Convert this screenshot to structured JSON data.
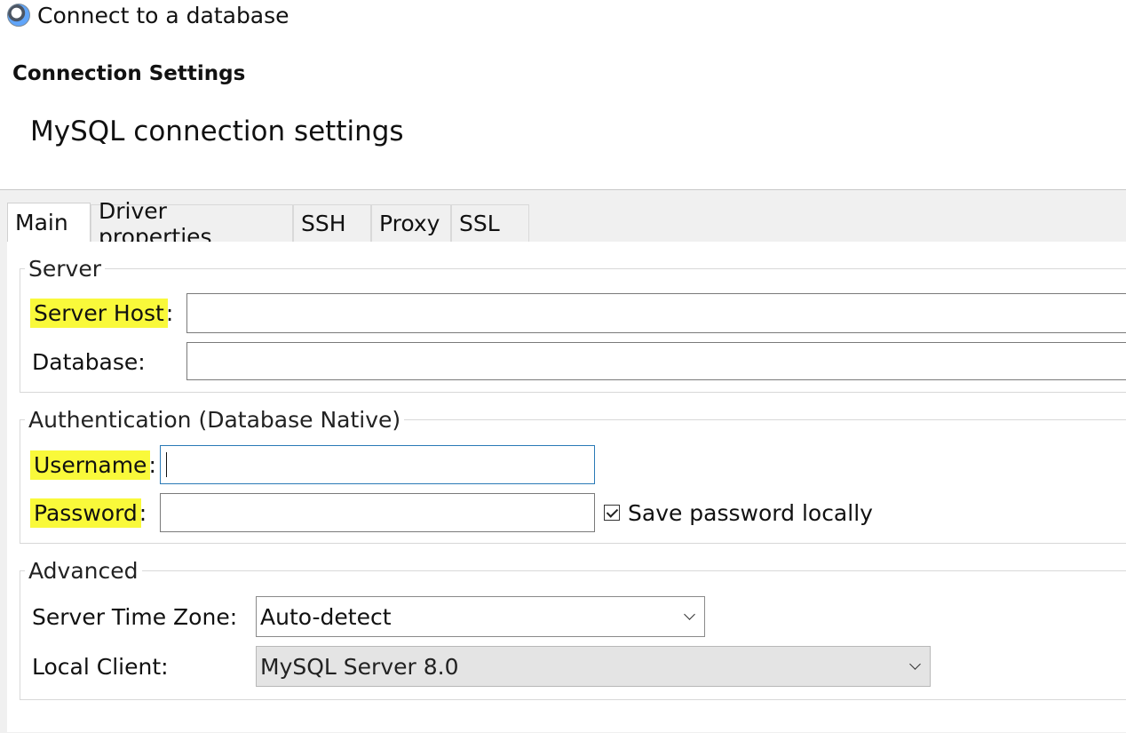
{
  "window": {
    "title": "Connect to a database",
    "icon": "dbeaver-app-icon"
  },
  "header": {
    "section_title": "Connection Settings",
    "subtitle": "MySQL connection settings"
  },
  "tabs": [
    {
      "label": "Main",
      "active": true
    },
    {
      "label": "Driver properties",
      "active": false
    },
    {
      "label": "SSH",
      "active": false
    },
    {
      "label": "Proxy",
      "active": false
    },
    {
      "label": "SSL",
      "active": false
    }
  ],
  "server": {
    "group_label": "Server",
    "host_label": "Server Host",
    "host_colon": ":",
    "host_value": "",
    "database_label": "Database:",
    "database_value": ""
  },
  "authentication": {
    "group_label": "Authentication (Database Native)",
    "username_label": "Username",
    "username_colon": ":",
    "username_value": "",
    "password_label": "Password",
    "password_colon": ":",
    "password_value": "",
    "save_password_label": "Save password locally",
    "save_password_checked": true
  },
  "advanced": {
    "group_label": "Advanced",
    "timezone_label": "Server Time Zone:",
    "timezone_value": "Auto-detect",
    "local_client_label": "Local Client:",
    "local_client_value": "MySQL Server 8.0"
  },
  "colors": {
    "highlight": "#f9f93a",
    "focus_border": "#2a7ab6"
  }
}
